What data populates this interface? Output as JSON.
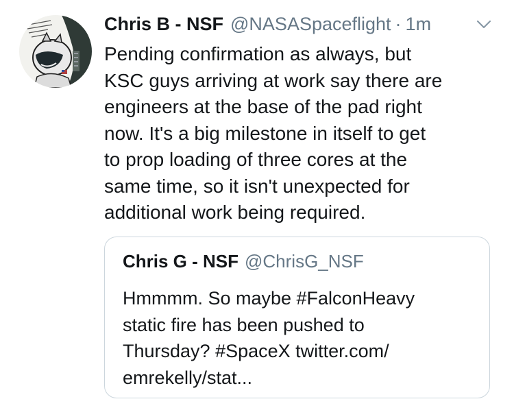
{
  "tweet": {
    "display_name": "Chris B - NSF",
    "handle": "@NASASpaceflight",
    "separator": "·",
    "time": "1m",
    "text": "Pending confirmation as always, but\nKSC guys arriving at work say there are\nengineers at the base of the pad right\nnow. It's a big milestone in itself to get\nto prop loading of three cores at the\nsame time, so it isn't unexpected for\nadditional work being required.",
    "menu_icon": "chevron-down-icon",
    "avatar_icon": "cartoon-astronaut-avatar"
  },
  "quote": {
    "display_name": "Chris G - NSF",
    "handle": "@ChrisG_NSF",
    "text": "Hmmmm.  So maybe #FalconHeavy\nstatic fire has been pushed to\nThursday?  #SpaceX twitter.com/\nemrekelly/stat..."
  },
  "colors": {
    "text": "#14171a",
    "secondary": "#657786",
    "border": "#ccd6dd"
  }
}
